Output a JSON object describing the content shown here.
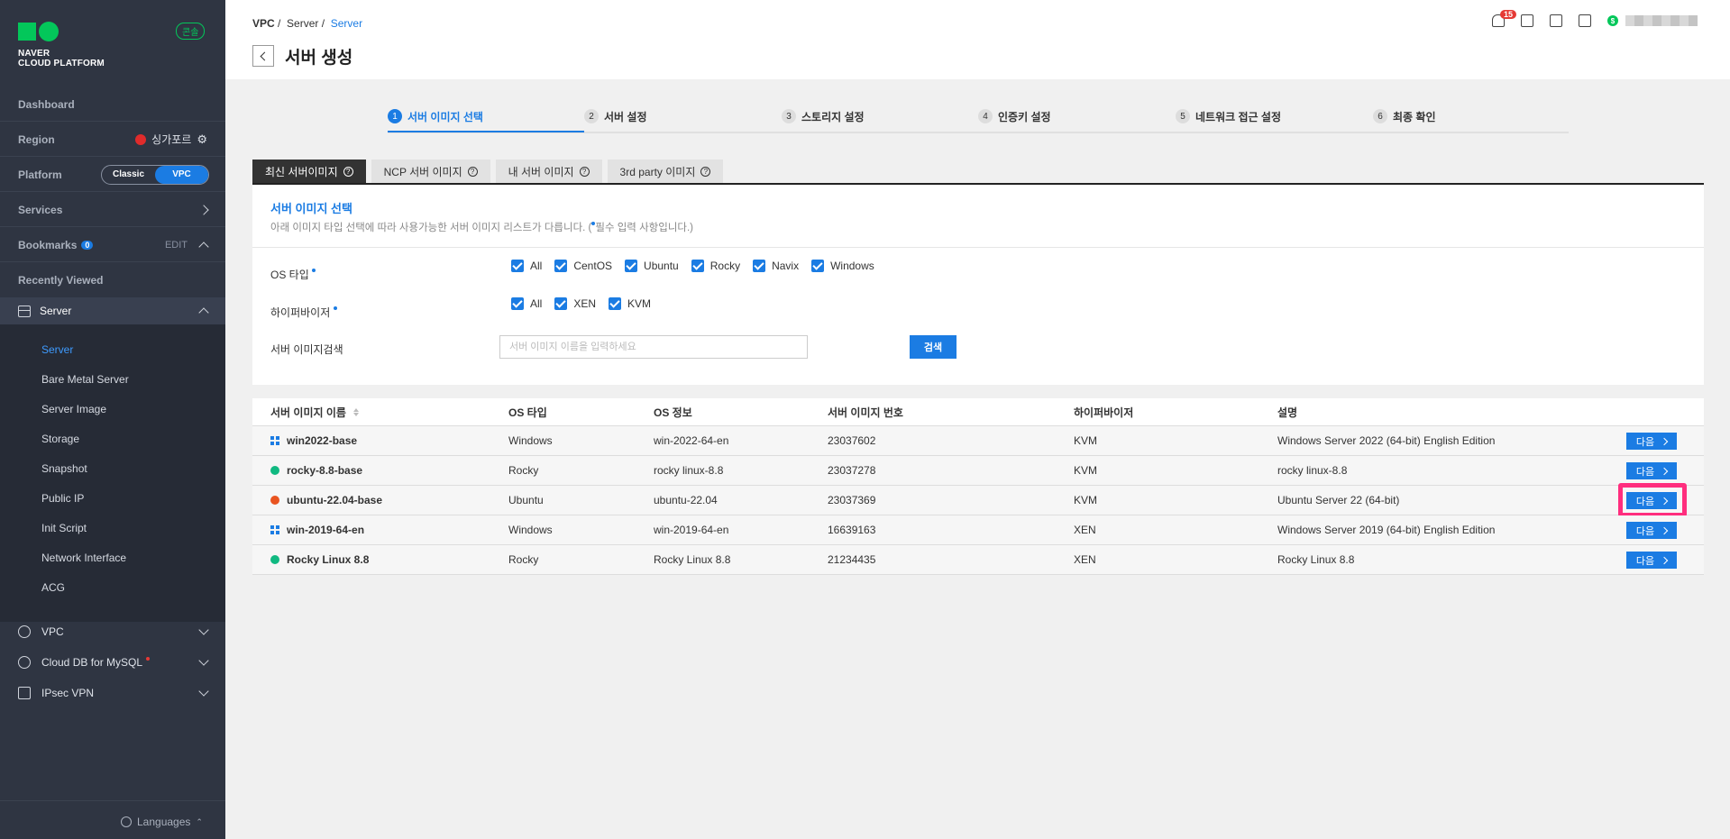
{
  "sidebar": {
    "logo_line1": "NAVER",
    "logo_line2": "CLOUD PLATFORM",
    "console_badge": "콘솔",
    "dashboard": "Dashboard",
    "region_label": "Region",
    "region_value": "싱가포르",
    "platform_label": "Platform",
    "platform_classic": "Classic",
    "platform_vpc": "VPC",
    "services": "Services",
    "bookmarks": "Bookmarks",
    "bookmarks_count": "0",
    "bookmarks_edit": "EDIT",
    "recently_viewed": "Recently Viewed",
    "server_group": "Server",
    "server_items": [
      "Server",
      "Bare Metal Server",
      "Server Image",
      "Storage",
      "Snapshot",
      "Public IP",
      "Init Script",
      "Network Interface",
      "ACG"
    ],
    "sections": [
      "VPC",
      "Cloud DB for MySQL",
      "IPsec VPN"
    ],
    "languages": "Languages"
  },
  "header": {
    "breadcrumb": [
      "VPC",
      "Server",
      "Server"
    ],
    "title": "서버 생성",
    "notification_count": "15"
  },
  "steps": [
    {
      "num": "1",
      "label": "서버 이미지 선택"
    },
    {
      "num": "2",
      "label": "서버 설정"
    },
    {
      "num": "3",
      "label": "스토리지 설정"
    },
    {
      "num": "4",
      "label": "인증키 설정"
    },
    {
      "num": "5",
      "label": "네트워크 접근 설정"
    },
    {
      "num": "6",
      "label": "최종 확인"
    }
  ],
  "image_tabs": [
    "최신 서버이미지",
    "NCP 서버 이미지",
    "내 서버 이미지",
    "3rd party 이미지"
  ],
  "filter": {
    "title": "서버 이미지 선택",
    "desc_before": "아래 이미지 타입 선택에 따라 사용가능한 서버 이미지 리스트가 다릅니다. (",
    "desc_after": "필수 입력 사항입니다.)",
    "os_label": "OS 타입",
    "os_options": [
      "All",
      "CentOS",
      "Ubuntu",
      "Rocky",
      "Navix",
      "Windows"
    ],
    "hv_label": "하이퍼바이저",
    "hv_options": [
      "All",
      "XEN",
      "KVM"
    ],
    "search_label": "서버 이미지검색",
    "search_placeholder": "서버 이미지 이름을 입력하세요",
    "search_button": "검색"
  },
  "table": {
    "columns": [
      "서버 이미지 이름",
      "OS 타입",
      "OS 정보",
      "서버 이미지 번호",
      "하이퍼바이저",
      "설명"
    ],
    "next_label": "다음",
    "rows": [
      {
        "name": "win2022-base",
        "icon": "windows-icon",
        "os": "Windows",
        "os_info": "win-2022-64-en",
        "number": "23037602",
        "hv": "KVM",
        "desc": "Windows Server 2022 (64-bit) English Edition"
      },
      {
        "name": "rocky-8.8-base",
        "icon": "rocky-icon",
        "os": "Rocky",
        "os_info": "rocky linux-8.8",
        "number": "23037278",
        "hv": "KVM",
        "desc": "rocky linux-8.8"
      },
      {
        "name": "ubuntu-22.04-base",
        "icon": "ubuntu-icon",
        "os": "Ubuntu",
        "os_info": "ubuntu-22.04",
        "number": "23037369",
        "hv": "KVM",
        "desc": "Ubuntu Server 22 (64-bit)"
      },
      {
        "name": "win-2019-64-en",
        "icon": "windows-icon",
        "os": "Windows",
        "os_info": "win-2019-64-en",
        "number": "16639163",
        "hv": "XEN",
        "desc": "Windows Server 2019 (64-bit) English Edition"
      },
      {
        "name": "Rocky Linux 8.8",
        "icon": "rocky-icon",
        "os": "Rocky",
        "os_info": "Rocky Linux 8.8",
        "number": "21234435",
        "hv": "XEN",
        "desc": "Rocky Linux 8.8"
      }
    ]
  },
  "colors": {
    "accent": "#1b7ce3",
    "sidebar": "#2f3542",
    "highlight": "#ff2e7e",
    "brand": "#03c75a"
  }
}
